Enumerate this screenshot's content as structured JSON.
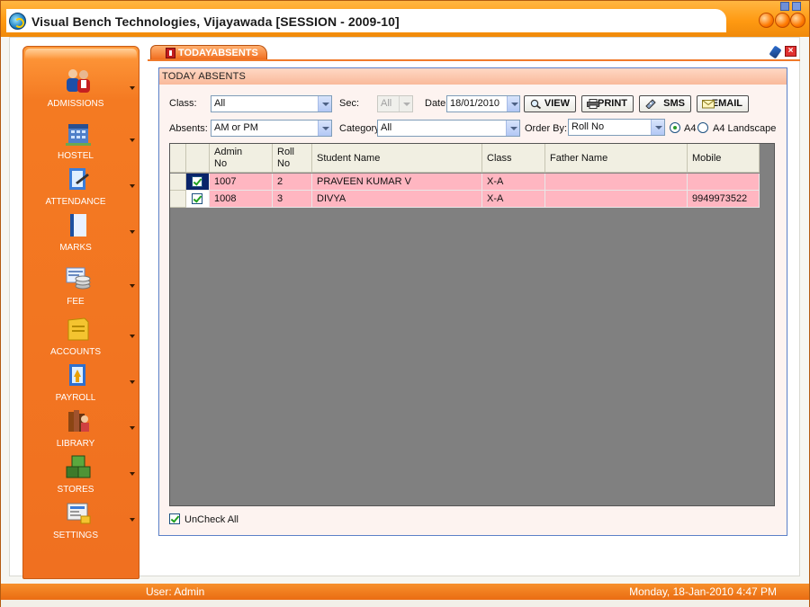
{
  "window": {
    "title": "Visual Bench Technologies, Vijayawada [SESSION - 2009-10]"
  },
  "sidebar": {
    "items": [
      {
        "label": "ADMISSIONS",
        "icon": "admissions-icon"
      },
      {
        "label": "HOSTEL",
        "icon": "hostel-icon"
      },
      {
        "label": "ATTENDANCE",
        "icon": "attendance-icon"
      },
      {
        "label": "MARKS",
        "icon": "marks-icon"
      },
      {
        "label": "FEE",
        "icon": "fee-icon"
      },
      {
        "label": "ACCOUNTS",
        "icon": "accounts-icon"
      },
      {
        "label": "PAYROLL",
        "icon": "payroll-icon"
      },
      {
        "label": "LIBRARY",
        "icon": "library-icon"
      },
      {
        "label": "STORES",
        "icon": "stores-icon"
      },
      {
        "label": "SETTINGS",
        "icon": "settings-icon"
      }
    ]
  },
  "tab": {
    "label": "TODAYABSENTS"
  },
  "panel": {
    "header": "TODAY ABSENTS",
    "filters": {
      "class_label": "Class:",
      "class_value": "All",
      "sec_label": "Sec:",
      "sec_value": "All",
      "date_label": "Date",
      "date_value": "18/01/2010",
      "absents_label": "Absents:",
      "absents_value": "AM or PM",
      "category_label": "Category:",
      "category_value": "All",
      "orderby_label": "Order By:",
      "orderby_value": "Roll No",
      "radio_a4": "A4",
      "radio_a4_landscape": "A4 Landscape",
      "selected_orientation": "A4"
    },
    "buttons": {
      "view": "VIEW",
      "print": "PRINT",
      "sms": "SMS",
      "email": "EMAIL"
    },
    "grid": {
      "columns": {
        "admin_no_1": "Admin",
        "admin_no_2": "No",
        "roll_no_1": "Roll",
        "roll_no_2": "No",
        "student_name": "Student Name",
        "class": "Class",
        "father_name": "Father Name",
        "mobile": "Mobile"
      },
      "rows": [
        {
          "checked": true,
          "admin_no": "1007",
          "roll_no": "2",
          "student_name": "PRAVEEN KUMAR V",
          "class": "X-A",
          "father_name": "",
          "mobile": ""
        },
        {
          "checked": true,
          "admin_no": "1008",
          "roll_no": "3",
          "student_name": "DIVYA",
          "class": "X-A",
          "father_name": "",
          "mobile": "9949973522"
        }
      ],
      "row_color": "#ffb6c1"
    },
    "uncheck_all_label": "UnCheck All"
  },
  "statusbar": {
    "user": "User: Admin",
    "datetime": "Monday, 18-Jan-2010 4:47 PM"
  },
  "colors": {
    "accent": "#f07020",
    "panel_border": "#5b80c8",
    "grid_background": "#808080"
  }
}
